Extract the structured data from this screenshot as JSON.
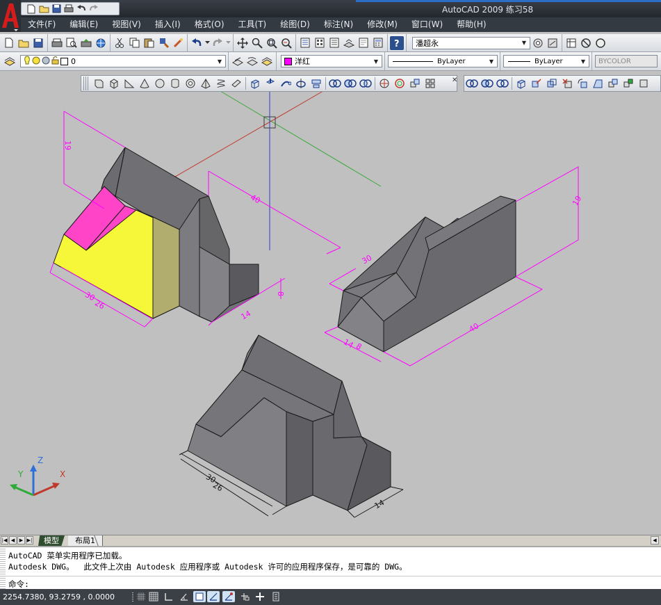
{
  "window": {
    "title": "AutoCAD 2009 练习58"
  },
  "menu": {
    "items": [
      {
        "label": "文件(F)"
      },
      {
        "label": "编辑(E)"
      },
      {
        "label": "视图(V)"
      },
      {
        "label": "插入(I)"
      },
      {
        "label": "格式(O)"
      },
      {
        "label": "工具(T)"
      },
      {
        "label": "绘图(D)"
      },
      {
        "label": "标注(N)"
      },
      {
        "label": "修改(M)"
      },
      {
        "label": "窗口(W)"
      },
      {
        "label": "帮助(H)"
      }
    ]
  },
  "toolbar": {
    "text_style": "潘超永"
  },
  "layers": {
    "current_layer": "0",
    "color": "洋红",
    "color_hex": "#ff00ff",
    "linetype": "ByLayer",
    "lineweight": "ByLayer",
    "plotstyle": "BYCOLOR"
  },
  "drawing": {
    "dim_labels": {
      "top_left_19": "19",
      "top_40": "40",
      "left_30": "30",
      "left_26": "26",
      "left_8": "8",
      "left_14": "14",
      "right_19": "19",
      "right_40": "40",
      "right_14": "14",
      "right_8": "8",
      "right_30": "30",
      "bottom_30": "30",
      "bottom_26": "26",
      "bottom_14": "14"
    },
    "ucs": {
      "x": "X",
      "y": "Y",
      "z": "Z"
    }
  },
  "tabs": {
    "model": "模型",
    "layout1": "布局1"
  },
  "command": {
    "line1": "AutoCAD 菜单实用程序已加载。",
    "line2": "Autodesk DWG。  此文件上次由 Autodesk 应用程序或 Autodesk 许可的应用程序保存，是可靠的 DWG。",
    "prompt": "命令:"
  },
  "status": {
    "coordinates": "2254.7380, 93.2759 , 0.0000"
  },
  "colors": {
    "magenta_face": "#ff44c8",
    "yellow_face": "#f7f73a",
    "olive_face": "#b0ad6e",
    "gray_face": "#6f6f74"
  }
}
